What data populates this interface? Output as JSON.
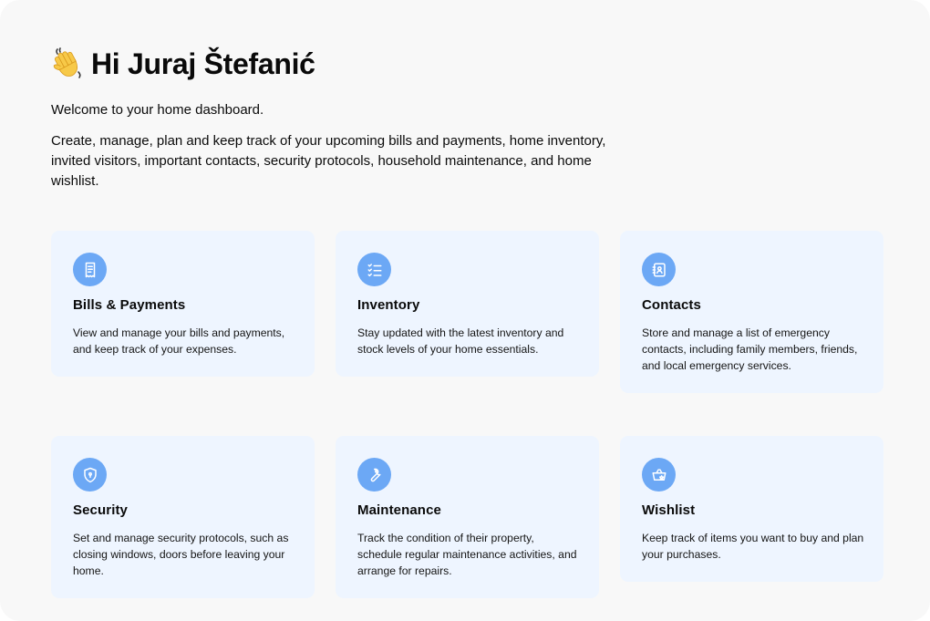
{
  "header": {
    "wave_icon": "waving-hand-icon",
    "greeting": "Hi Juraj Štefanić",
    "intro": "Welcome to your home dashboard.",
    "description": "Create, manage, plan and keep track of your upcoming bills and payments, home inventory, invited visitors, important contacts, security protocols, household maintenance, and home wishlist."
  },
  "colors": {
    "background": "#f8f8f8",
    "card_background": "#eef5ff",
    "icon_circle": "#6ca8f5",
    "text": "#0a0a0a"
  },
  "cards": [
    {
      "icon": "receipt-icon",
      "title": "Bills & Payments",
      "text": "View and manage your bills and payments, and keep track of your expenses."
    },
    {
      "icon": "checklist-icon",
      "title": "Inventory",
      "text": "Stay updated with the latest inventory and stock levels of your home essentials."
    },
    {
      "icon": "contact-book-icon",
      "title": "Contacts",
      "text": "Store and manage a list of emergency contacts, including family members, friends, and local emergency services."
    },
    {
      "icon": "shield-icon",
      "title": "Security",
      "text": "Set and manage security protocols, such as closing windows, doors before leaving your home."
    },
    {
      "icon": "wrench-icon",
      "title": "Maintenance",
      "text": "Track the condition of their property, schedule regular maintenance activities, and arrange for repairs."
    },
    {
      "icon": "shopping-basket-icon",
      "title": "Wishlist",
      "text": "Keep track of items you want to buy and plan your purchases."
    }
  ]
}
